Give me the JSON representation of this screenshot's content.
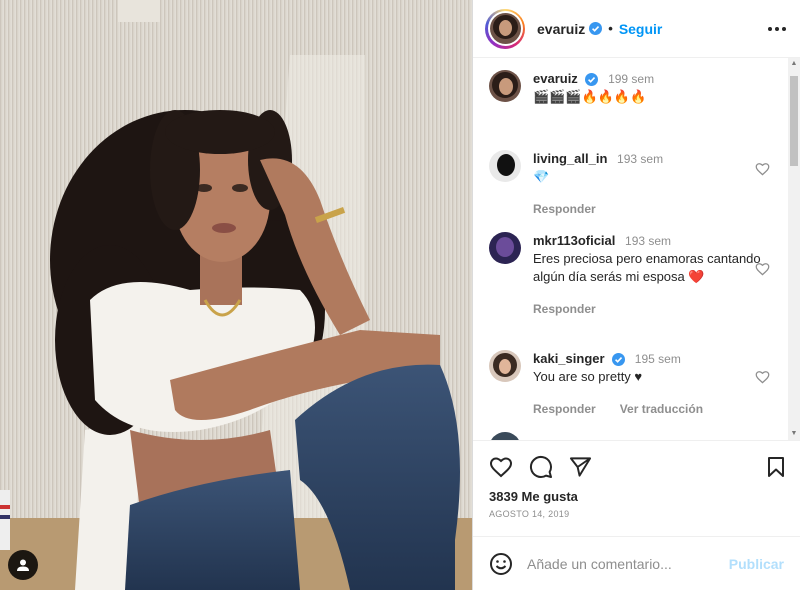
{
  "post": {
    "username": "evaruiz",
    "follow_label": "Seguir",
    "separator": "•",
    "caption": {
      "username": "evaruiz",
      "time": "199 sem",
      "text": "🎬🎬🎬🔥🔥🔥🔥"
    },
    "comments": [
      {
        "username": "living_all_in",
        "time": "193 sem",
        "text": "💎",
        "reply_label": "Responder",
        "translate_label": ""
      },
      {
        "username": "mkr113oficial",
        "time": "193 sem",
        "text": "Eres preciosa pero enamoras cantando algún día serás mi esposa ❤️",
        "reply_label": "Responder",
        "translate_label": ""
      },
      {
        "username": "kaki_singer",
        "time": "195 sem",
        "text": "You are so pretty ♥",
        "reply_label": "Responder",
        "translate_label": "Ver traducción"
      }
    ],
    "likes": "3839 Me gusta",
    "date": "AGOSTO 14, 2019",
    "comment_placeholder": "Añade un comentario...",
    "publish_label": "Publicar"
  },
  "colors": {
    "accent": "#0095f6",
    "verified": "#3897f0",
    "publish_disabled": "#b2dffc",
    "heart_red": "#ed4956"
  },
  "icons": [
    "more-icon",
    "verified-icon",
    "heart-icon",
    "comment-icon",
    "share-icon",
    "save-icon",
    "emoji-icon",
    "user-tag-icon"
  ]
}
